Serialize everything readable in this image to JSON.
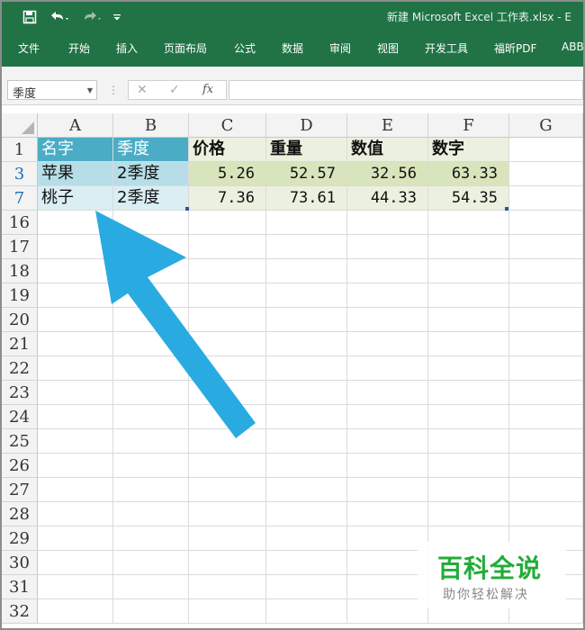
{
  "window": {
    "title": "新建 Microsoft Excel 工作表.xlsx  -  E"
  },
  "quick_access": {
    "save_icon": "save-icon",
    "undo_icon": "undo-icon",
    "redo_icon": "redo-icon",
    "customize_icon": "customize-icon"
  },
  "ribbon": {
    "tabs": [
      "文件",
      "开始",
      "插入",
      "页面布局",
      "公式",
      "数据",
      "审阅",
      "视图",
      "开发工具",
      "福昕PDF",
      "ABB"
    ]
  },
  "formula_bar": {
    "name_box": "季度",
    "cancel_icon": "✕",
    "enter_icon": "✓",
    "fx_label": "fx",
    "formula": ""
  },
  "grid": {
    "columns": [
      "A",
      "B",
      "C",
      "D",
      "E",
      "F",
      "G"
    ],
    "rows": [
      "1",
      "3",
      "7",
      "16",
      "17",
      "18",
      "19",
      "20",
      "21",
      "22",
      "23",
      "24",
      "25",
      "26",
      "27",
      "28",
      "29",
      "30",
      "31",
      "32"
    ],
    "header_row": [
      "名字",
      "季度",
      "价格",
      "重量",
      "数值",
      "数字"
    ],
    "data_rows": [
      [
        "苹果",
        "2季度",
        "5.26",
        "52.57",
        "32.56",
        "63.33"
      ],
      [
        "桃子",
        "2季度",
        "7.36",
        "73.61",
        "44.33",
        "54.35"
      ]
    ]
  },
  "colors": {
    "excel_green": "#217346",
    "header_blue": "#4bacc6",
    "header_green_light": "#ebf1de",
    "arrow": "#29abe2",
    "watermark_green": "#22ac38"
  },
  "watermark": {
    "title": "百科全说",
    "subtitle": "助你轻松解决"
  }
}
